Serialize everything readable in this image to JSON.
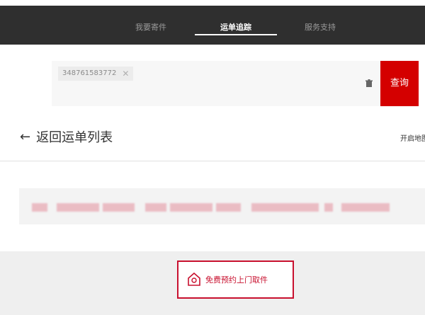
{
  "nav": {
    "items": [
      {
        "label": "我要寄件"
      },
      {
        "label": "运单追踪"
      },
      {
        "label": "服务支持"
      }
    ]
  },
  "search": {
    "tag_value": "348761583772",
    "query_label": "查询"
  },
  "back": {
    "label": "返回运单列表"
  },
  "map_toggle": {
    "label": "开启地图"
  },
  "pickup": {
    "label": "免费预约上门取件"
  },
  "colors": {
    "brand_red": "#d40000",
    "nav_bg": "#2f2f2f"
  }
}
